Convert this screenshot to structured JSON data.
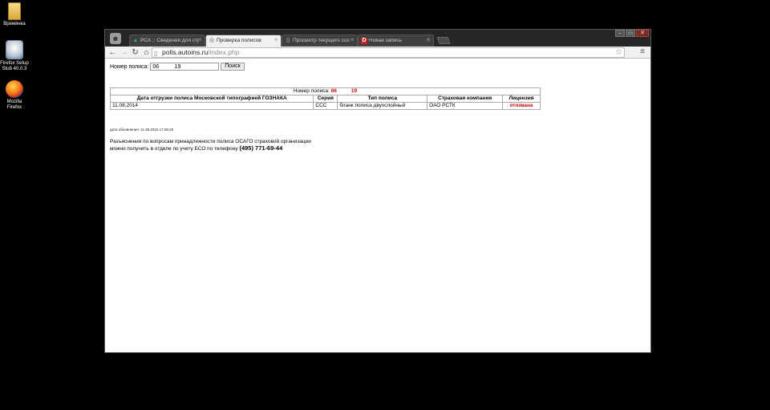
{
  "desktop": {
    "icons": [
      {
        "label": "Времянка"
      },
      {
        "label": "Firefox Setup Stub 40.0.3"
      },
      {
        "label": "Mozilla Firefox"
      }
    ]
  },
  "browser": {
    "tabs": [
      {
        "title": "РСА :: Сведения для стр",
        "icon": "rsa-favicon"
      },
      {
        "title": "Проверка полисов",
        "icon": "polis-favicon",
        "active": true
      },
      {
        "title": "Просмотр текущего сос",
        "icon": "page-favicon"
      },
      {
        "title": "Новая запись",
        "icon": "red-d-favicon"
      }
    ],
    "url_host": "polis.autoins.ru",
    "url_path": "/index.php"
  },
  "page": {
    "search_label": "Номер полиса:",
    "search_value": "06          19",
    "search_button": "Поиск",
    "result_caption_label": "Номер полиса:",
    "result_caption_value": "06          19",
    "columns": [
      "Дата отгрузки полиса Московской типографией ГОЗНАКА",
      "Серия",
      "Тип полиса",
      "Страховая компания",
      "Лицензия"
    ],
    "row": {
      "date": "11.08.2014",
      "series": "ССС",
      "type": "бланк полиса двухслойный",
      "company": "ОАО РСТК",
      "license": "отозвана"
    },
    "updated": "дата обновления: 11.09.2015 17:08:25",
    "info_line1": "Разъяснения по вопросам принадлежности полиса ОСАГО страховой организации",
    "info_line2": "можно получить в отделе по учету БСО по телефону",
    "phone": "(495) 771-69-44"
  }
}
